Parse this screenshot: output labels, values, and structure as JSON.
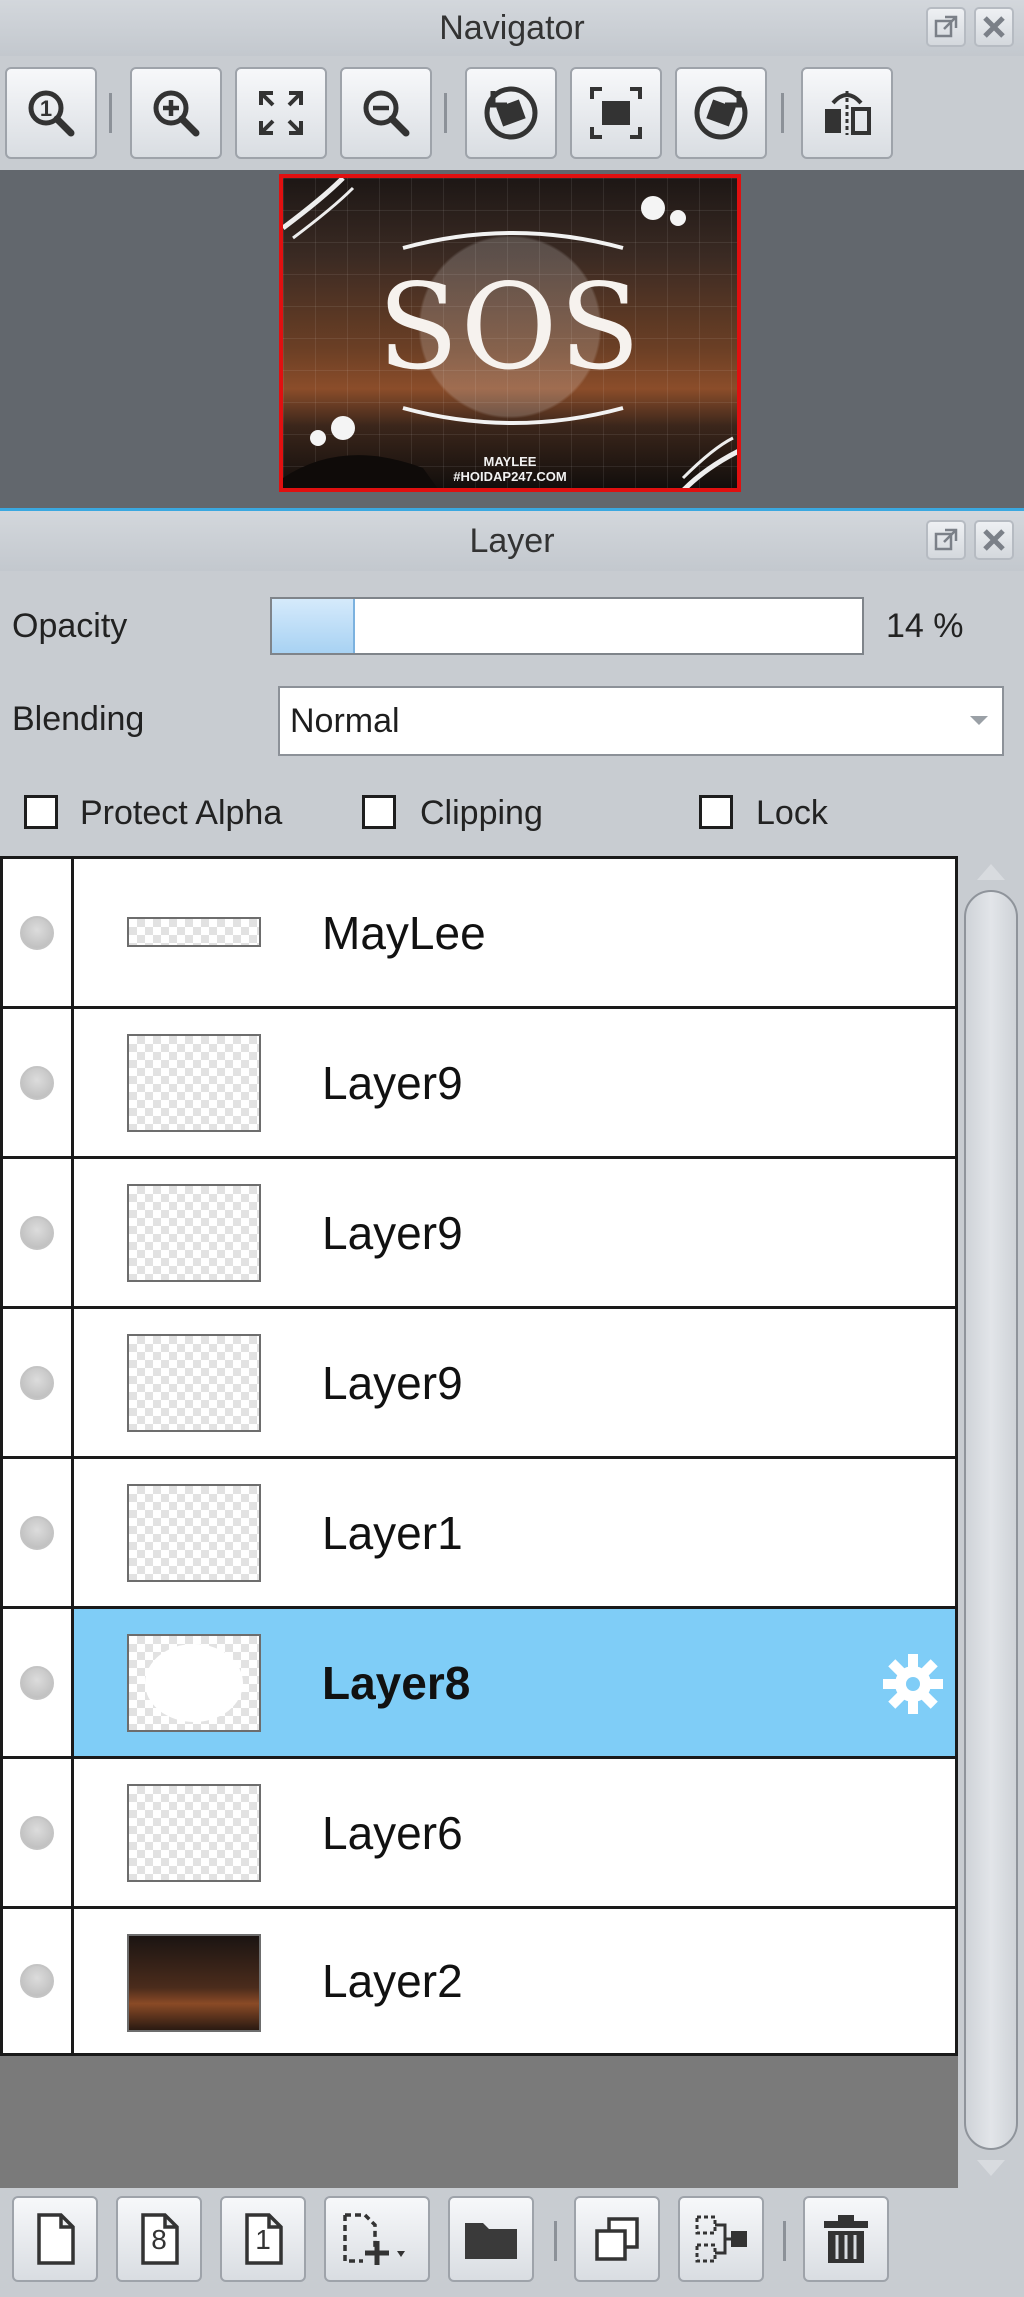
{
  "navigator": {
    "title": "Navigator",
    "toolbar": [
      {
        "icon": "zoom-actual-size-icon"
      },
      {
        "icon": "zoom-in-icon"
      },
      {
        "icon": "fit-to-window-icon"
      },
      {
        "icon": "zoom-out-icon"
      },
      {
        "icon": "rotate-left-icon"
      },
      {
        "icon": "reset-view-icon"
      },
      {
        "icon": "rotate-right-icon"
      },
      {
        "icon": "flip-horizontal-icon"
      }
    ],
    "preview": {
      "title_text": "SOS",
      "caption_line1": "MAYLEE",
      "caption_line2": "#HOIDAP247.COM"
    }
  },
  "layer_panel": {
    "title": "Layer",
    "opacity_label": "Opacity",
    "opacity_value": 14,
    "opacity_text": "14 %",
    "blending_label": "Blending",
    "blending_value": "Normal",
    "protect_alpha_label": "Protect Alpha",
    "clipping_label": "Clipping",
    "lock_label": "Lock",
    "layers": [
      {
        "name": "MayLee",
        "thumb": "thin"
      },
      {
        "name": "Layer9",
        "thumb": "transparent"
      },
      {
        "name": "Layer9",
        "thumb": "transparent"
      },
      {
        "name": "Layer9",
        "thumb": "transparent"
      },
      {
        "name": "Layer1",
        "thumb": "transparent"
      },
      {
        "name": "Layer8",
        "thumb": "ellipse",
        "selected": true
      },
      {
        "name": "Layer6",
        "thumb": "transparent"
      },
      {
        "name": "Layer2",
        "thumb": "photo"
      }
    ],
    "bottom_toolbar": [
      {
        "icon": "new-layer-icon"
      },
      {
        "icon": "new-8bit-layer-icon",
        "text": "8"
      },
      {
        "icon": "new-1bit-layer-icon",
        "text": "1"
      },
      {
        "icon": "add-layer-dropdown-icon"
      },
      {
        "icon": "new-folder-icon"
      },
      {
        "icon": "duplicate-layer-icon"
      },
      {
        "icon": "merge-down-icon"
      },
      {
        "icon": "delete-layer-icon"
      }
    ]
  },
  "colors": {
    "selection": "#7fcdf7",
    "preview_border": "#e01010",
    "panel_bg": "#c8ccd1",
    "list_bg": "#7a7a7a"
  }
}
